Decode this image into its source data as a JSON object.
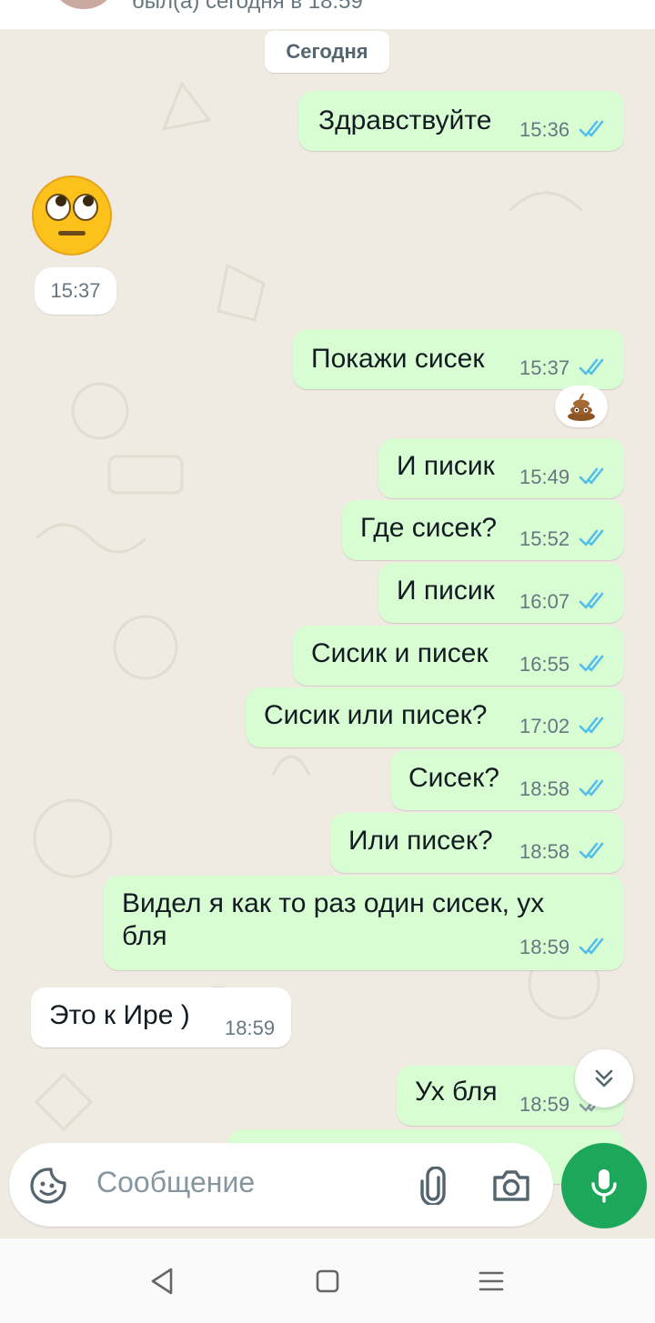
{
  "header": {
    "status": "был(а) сегодня в 18:59"
  },
  "chat": {
    "date_label": "Сегодня",
    "emoji_message": {
      "emoji": "rolling-eyes-face",
      "time": "15:37"
    },
    "reaction": "pile-of-poo",
    "messages": [
      {
        "dir": "out",
        "text": "Здравствуйте",
        "time": "15:36",
        "read": true
      },
      {
        "dir": "out",
        "text": "Покажи сисек",
        "time": "15:37",
        "read": true
      },
      {
        "dir": "out",
        "text": "И писик",
        "time": "15:49",
        "read": true
      },
      {
        "dir": "out",
        "text": "Где сисек?",
        "time": "15:52",
        "read": true
      },
      {
        "dir": "out",
        "text": "И писик",
        "time": "16:07",
        "read": true
      },
      {
        "dir": "out",
        "text": "Сисик и писек",
        "time": "16:55",
        "read": true
      },
      {
        "dir": "out",
        "text": "Сисик или писек?",
        "time": "17:02",
        "read": true
      },
      {
        "dir": "out",
        "text": "Сисек?",
        "time": "18:58",
        "read": true
      },
      {
        "dir": "out",
        "text": "Или писек?",
        "time": "18:58",
        "read": true
      },
      {
        "dir": "out",
        "text": "Видел я как то раз один сисек, ух",
        "text2": "бля",
        "time": "18:59",
        "read": true
      },
      {
        "dir": "in",
        "text": "Это к Ире )",
        "time": "18:59"
      },
      {
        "dir": "out",
        "text": "Ух бля",
        "time": "18:59",
        "read": false
      }
    ]
  },
  "composer": {
    "placeholder": "Сообщение"
  },
  "colors": {
    "outgoing": "#d9fdd3",
    "incoming": "#ffffff",
    "read_ticks": "#53bdeb",
    "mic": "#1da75a"
  },
  "icons": [
    "sticker-icon",
    "attach-icon",
    "camera-icon",
    "mic-icon",
    "chevrons-down-icon",
    "nav-back-icon",
    "nav-home-icon",
    "nav-recents-icon"
  ]
}
